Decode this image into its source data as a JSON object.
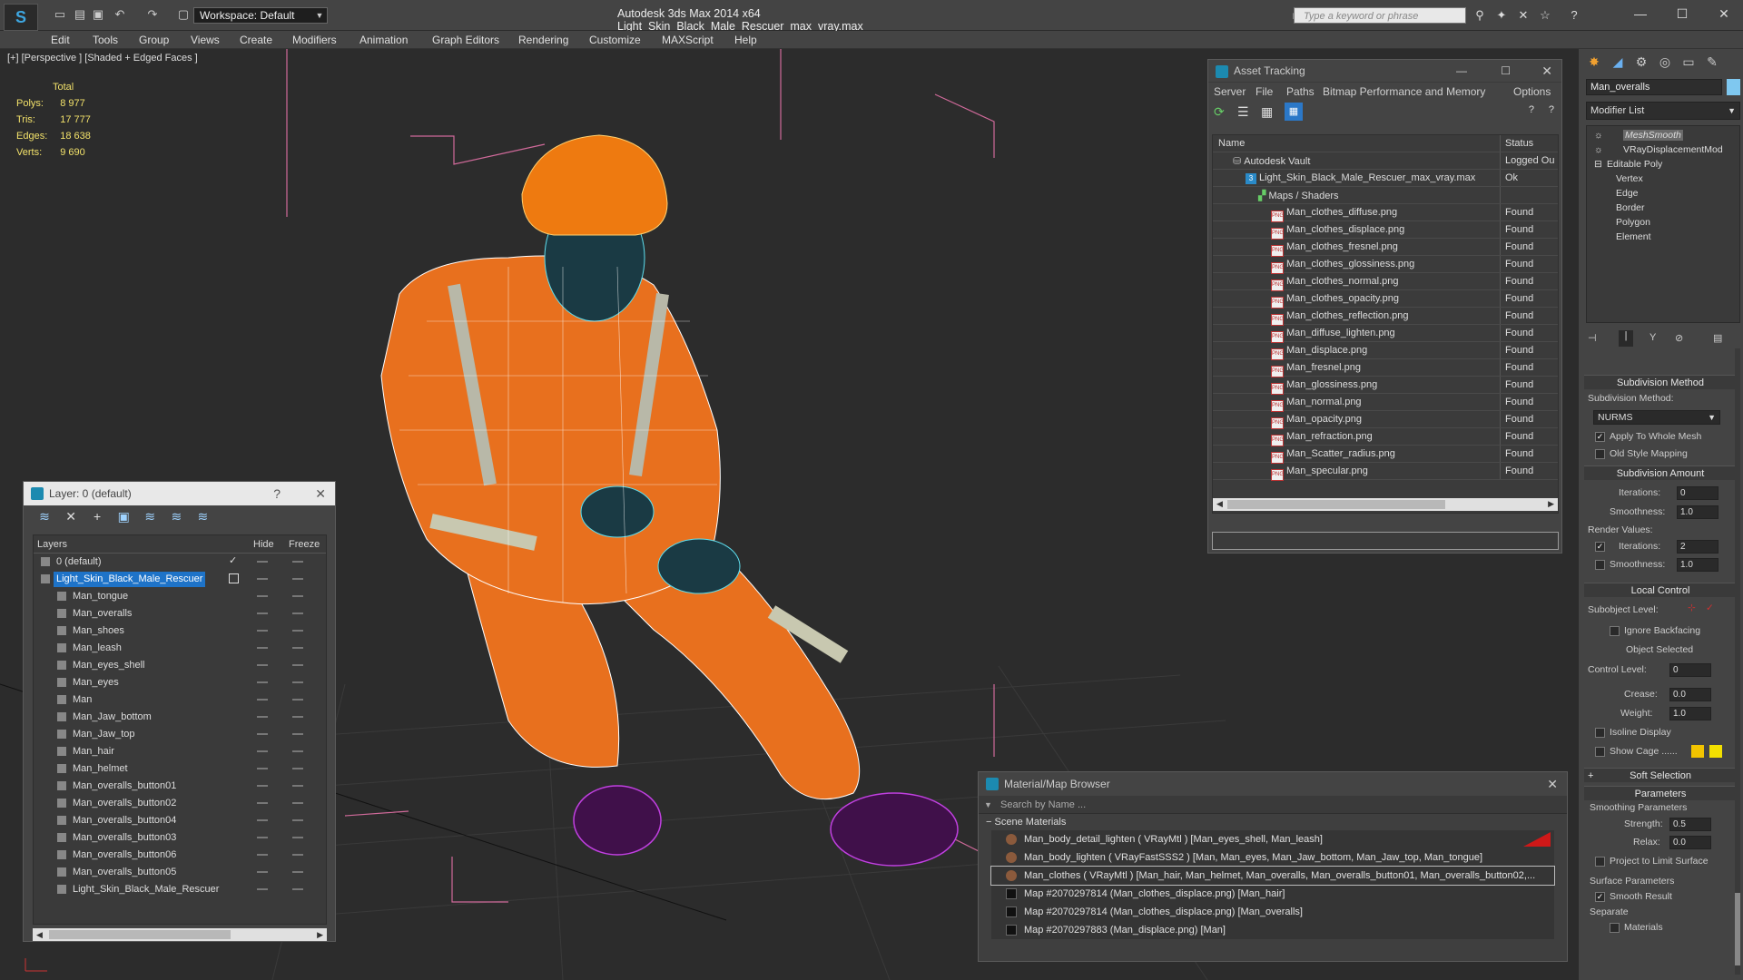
{
  "titlebar": {
    "workspace": "Workspace: Default",
    "app_title": "Autodesk 3ds Max  2014 x64     Light_Skin_Black_Male_Rescuer_max_vray.max",
    "search_placeholder": "Type a keyword or phrase"
  },
  "menu": [
    "Edit",
    "Tools",
    "Group",
    "Views",
    "Create",
    "Modifiers",
    "Animation",
    "Graph Editors",
    "Rendering",
    "Customize",
    "MAXScript",
    "Help"
  ],
  "viewport": {
    "label": "[+] [Perspective ] [Shaded + Edged Faces ]",
    "stats": {
      "header": "Total",
      "rows": [
        {
          "label": "Polys:",
          "value": "8 977"
        },
        {
          "label": "Tris:",
          "value": "17 777"
        },
        {
          "label": "Edges:",
          "value": "18 638"
        },
        {
          "label": "Verts:",
          "value": "9 690"
        }
      ]
    }
  },
  "layer_panel": {
    "title": "Layer: 0 (default)",
    "help": "?",
    "columns": {
      "name": "Layers",
      "hide": "Hide",
      "freeze": "Freeze"
    },
    "rows": [
      {
        "name": "0 (default)",
        "level": 1,
        "checked": true
      },
      {
        "name": "Light_Skin_Black_Male_Rescuer",
        "level": 1,
        "selected": true
      },
      {
        "name": "Man_tongue",
        "level": 2
      },
      {
        "name": "Man_overalls",
        "level": 2
      },
      {
        "name": "Man_shoes",
        "level": 2
      },
      {
        "name": "Man_leash",
        "level": 2
      },
      {
        "name": "Man_eyes_shell",
        "level": 2
      },
      {
        "name": "Man_eyes",
        "level": 2
      },
      {
        "name": "Man",
        "level": 2
      },
      {
        "name": "Man_Jaw_bottom",
        "level": 2
      },
      {
        "name": "Man_Jaw_top",
        "level": 2
      },
      {
        "name": "Man_hair",
        "level": 2
      },
      {
        "name": "Man_helmet",
        "level": 2
      },
      {
        "name": "Man_overalls_button01",
        "level": 2
      },
      {
        "name": "Man_overalls_button02",
        "level": 2
      },
      {
        "name": "Man_overalls_button04",
        "level": 2
      },
      {
        "name": "Man_overalls_button03",
        "level": 2
      },
      {
        "name": "Man_overalls_button06",
        "level": 2
      },
      {
        "name": "Man_overalls_button05",
        "level": 2
      },
      {
        "name": "Light_Skin_Black_Male_Rescuer",
        "level": 2
      }
    ]
  },
  "asset_panel": {
    "title": "Asset Tracking",
    "menu": [
      "Server",
      "File",
      "Paths",
      "Bitmap Performance and Memory",
      "Options"
    ],
    "columns": {
      "name": "Name",
      "status": "Status"
    },
    "rows": [
      {
        "name": "Autodesk Vault",
        "status": "Logged Ou",
        "level": 0,
        "icon": "vault"
      },
      {
        "name": "Light_Skin_Black_Male_Rescuer_max_vray.max",
        "status": "Ok",
        "level": 1,
        "icon": "max"
      },
      {
        "name": "Maps / Shaders",
        "status": "",
        "level": 2,
        "icon": "maps"
      },
      {
        "name": "Man_clothes_diffuse.png",
        "status": "Found",
        "level": 3,
        "icon": "png"
      },
      {
        "name": "Man_clothes_displace.png",
        "status": "Found",
        "level": 3,
        "icon": "png"
      },
      {
        "name": "Man_clothes_fresnel.png",
        "status": "Found",
        "level": 3,
        "icon": "png"
      },
      {
        "name": "Man_clothes_glossiness.png",
        "status": "Found",
        "level": 3,
        "icon": "png"
      },
      {
        "name": "Man_clothes_normal.png",
        "status": "Found",
        "level": 3,
        "icon": "png"
      },
      {
        "name": "Man_clothes_opacity.png",
        "status": "Found",
        "level": 3,
        "icon": "png"
      },
      {
        "name": "Man_clothes_reflection.png",
        "status": "Found",
        "level": 3,
        "icon": "png"
      },
      {
        "name": "Man_diffuse_lighten.png",
        "status": "Found",
        "level": 3,
        "icon": "png"
      },
      {
        "name": "Man_displace.png",
        "status": "Found",
        "level": 3,
        "icon": "png"
      },
      {
        "name": "Man_fresnel.png",
        "status": "Found",
        "level": 3,
        "icon": "png"
      },
      {
        "name": "Man_glossiness.png",
        "status": "Found",
        "level": 3,
        "icon": "png"
      },
      {
        "name": "Man_normal.png",
        "status": "Found",
        "level": 3,
        "icon": "png"
      },
      {
        "name": "Man_opacity.png",
        "status": "Found",
        "level": 3,
        "icon": "png"
      },
      {
        "name": "Man_refraction.png",
        "status": "Found",
        "level": 3,
        "icon": "png"
      },
      {
        "name": "Man_Scatter_radius.png",
        "status": "Found",
        "level": 3,
        "icon": "png"
      },
      {
        "name": "Man_specular.png",
        "status": "Found",
        "level": 3,
        "icon": "png"
      }
    ]
  },
  "material_browser": {
    "title": "Material/Map Browser",
    "search_placeholder": "Search by Name ...",
    "section": "Scene Materials",
    "rows": [
      {
        "text": "Man_body_detail_lighten  ( VRayMtl ) [Man_eyes_shell, Man_leash]",
        "kind": "mtl"
      },
      {
        "text": "Man_body_lighten  ( VRayFastSSS2 ) [Man, Man_eyes, Man_Jaw_bottom, Man_Jaw_top, Man_tongue]",
        "kind": "mtl"
      },
      {
        "text": "Man_clothes  ( VRayMtl ) [Man_hair, Man_helmet, Man_overalls, Man_overalls_button01, Man_overalls_button02,...",
        "kind": "mtl"
      },
      {
        "text": "Map #2070297814 (Man_clothes_displace.png) [Man_hair]",
        "kind": "map"
      },
      {
        "text": "Map #2070297814 (Man_clothes_displace.png) [Man_overalls]",
        "kind": "map"
      },
      {
        "text": "Map #2070297883 (Man_displace.png) [Man]",
        "kind": "map"
      }
    ]
  },
  "command_panel": {
    "object_name": "Man_overalls",
    "modifier_list": "Modifier List",
    "stack": [
      "MeshSmooth",
      "VRayDisplacementMod",
      "Editable Poly",
      "Vertex",
      "Edge",
      "Border",
      "Polygon",
      "Element"
    ],
    "subdivision_method": {
      "header": "Subdivision Method",
      "label": "Subdivision Method:",
      "value": "NURMS",
      "apply_whole": "Apply To Whole Mesh",
      "old_style": "Old Style Mapping"
    },
    "subdivision_amount": {
      "header": "Subdivision Amount",
      "iterations_label": "Iterations:",
      "iterations": "0",
      "smoothness_label": "Smoothness:",
      "smoothness": "1.0",
      "render_values": "Render Values:",
      "r_iterations_label": "Iterations:",
      "r_iterations": "2",
      "r_smoothness_label": "Smoothness:",
      "r_smoothness": "1.0"
    },
    "local_control": {
      "header": "Local Control",
      "subobject_label": "Subobject Level:",
      "ignore_backfacing": "Ignore Backfacing",
      "object_selected": "Object Selected",
      "control_level_label": "Control Level:",
      "control_level": "0",
      "crease_label": "Crease:",
      "crease": "0.0",
      "weight_label": "Weight:",
      "weight": "1.0",
      "isoline": "Isoline Display",
      "show_cage": "Show Cage ......"
    },
    "soft_selection": "Soft Selection",
    "parameters": {
      "header": "Parameters",
      "smoothing": "Smoothing Parameters",
      "strength_label": "Strength:",
      "strength": "0.5",
      "relax_label": "Relax:",
      "relax": "0.0",
      "project": "Project to Limit Surface",
      "surface": "Surface Parameters",
      "smooth_result": "Smooth Result",
      "separate": "Separate",
      "materials": "Materials"
    }
  },
  "colors": {
    "accent": "#1e73c8",
    "cage_a": "#f2c400",
    "cage_b": "#f2e000",
    "overalls": "#e8701e",
    "wire": "#ffffff"
  }
}
